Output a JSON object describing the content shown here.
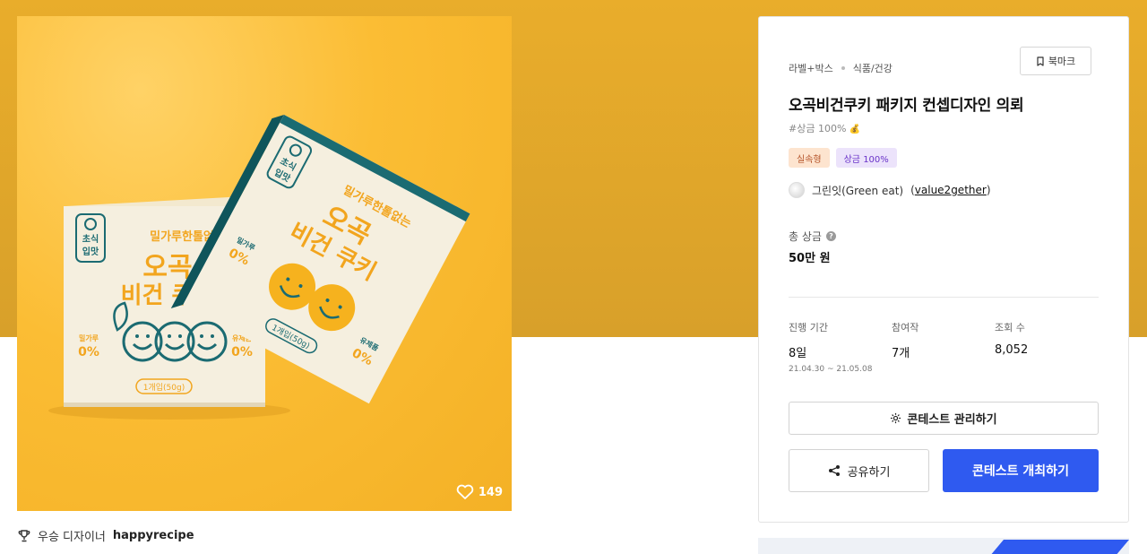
{
  "hero": {
    "likes": "149",
    "packaging": {
      "brand": "초식입맛",
      "brand_line1": "초식",
      "brand_line2": "입맛",
      "slogan": "밀가루한톨없는",
      "name_line1": "오곡",
      "name_line2": "비건 쿠키",
      "badge_left_label": "밀가루",
      "badge_left_value": "0%",
      "badge_right_label": "유제품",
      "badge_right_value": "0%",
      "serving": "1개입(50g)"
    }
  },
  "winner": {
    "label": "우승 디자이너",
    "name": "happyrecipe"
  },
  "panel": {
    "breadcrumb": [
      "라벨+박스",
      "식품/건강"
    ],
    "bookmark_label": "북마크",
    "title": "오곡비건쿠키 패키지 컨셉디자인 의뢰",
    "tagline": "#상금 100%",
    "badges": [
      "실속형",
      "상금 100%"
    ],
    "owner": {
      "name": "그린잇(Green eat)",
      "handle_open": "(",
      "handle": "value2gether",
      "handle_close": ")"
    },
    "prize": {
      "label": "총 상금",
      "value": "50만 원"
    },
    "stats": {
      "period": {
        "label": "진행 기간",
        "value": "8일",
        "range": "21.04.30 ~ 21.05.08"
      },
      "entries": {
        "label": "참여작",
        "value": "7개"
      },
      "views": {
        "label": "조회 수",
        "value": "8,052"
      }
    },
    "manage_label": "콘테스트 관리하기",
    "share_label": "공유하기",
    "host_label": "콘테스트 개최하기"
  },
  "colors": {
    "band": "#e2a82b",
    "hero_bg": "#fbbd34",
    "teal": "#1b6b72",
    "cream": "#f5efdf",
    "accent": "#2f5af0"
  }
}
